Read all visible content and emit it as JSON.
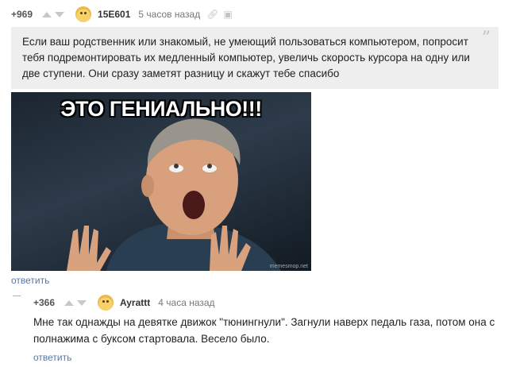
{
  "comment": {
    "rating": "+969",
    "author": "15E601",
    "time": "5 часов назад",
    "text": "Если ваш родственник или знакомый, не умеющий пользоваться компьютером, попросит тебя подремонтировать их медленный компьютер, увеличь скорость курсора на одну или две ступени. Они сразу заметят разницу и скажут тебе спасибо",
    "image_caption": "ЭТО ГЕНИАЛЬНО!!!",
    "image_watermark": "memesmop.net",
    "reply_label": "ответить"
  },
  "reply": {
    "rating": "+366",
    "author": "Ayrattt",
    "time": "4 часа назад",
    "text": "Мне так однажды на девятке движок \"тюнингнули\". Загнули наверх педаль газа, потом она с полнажима с буксом стартовала. Весело было.",
    "reply_label": "ответить"
  },
  "icons": {
    "vote_up": "arrow-up-icon",
    "vote_down": "arrow-down-icon",
    "link": "link-icon",
    "save": "save-icon",
    "quote": "quote-icon"
  }
}
